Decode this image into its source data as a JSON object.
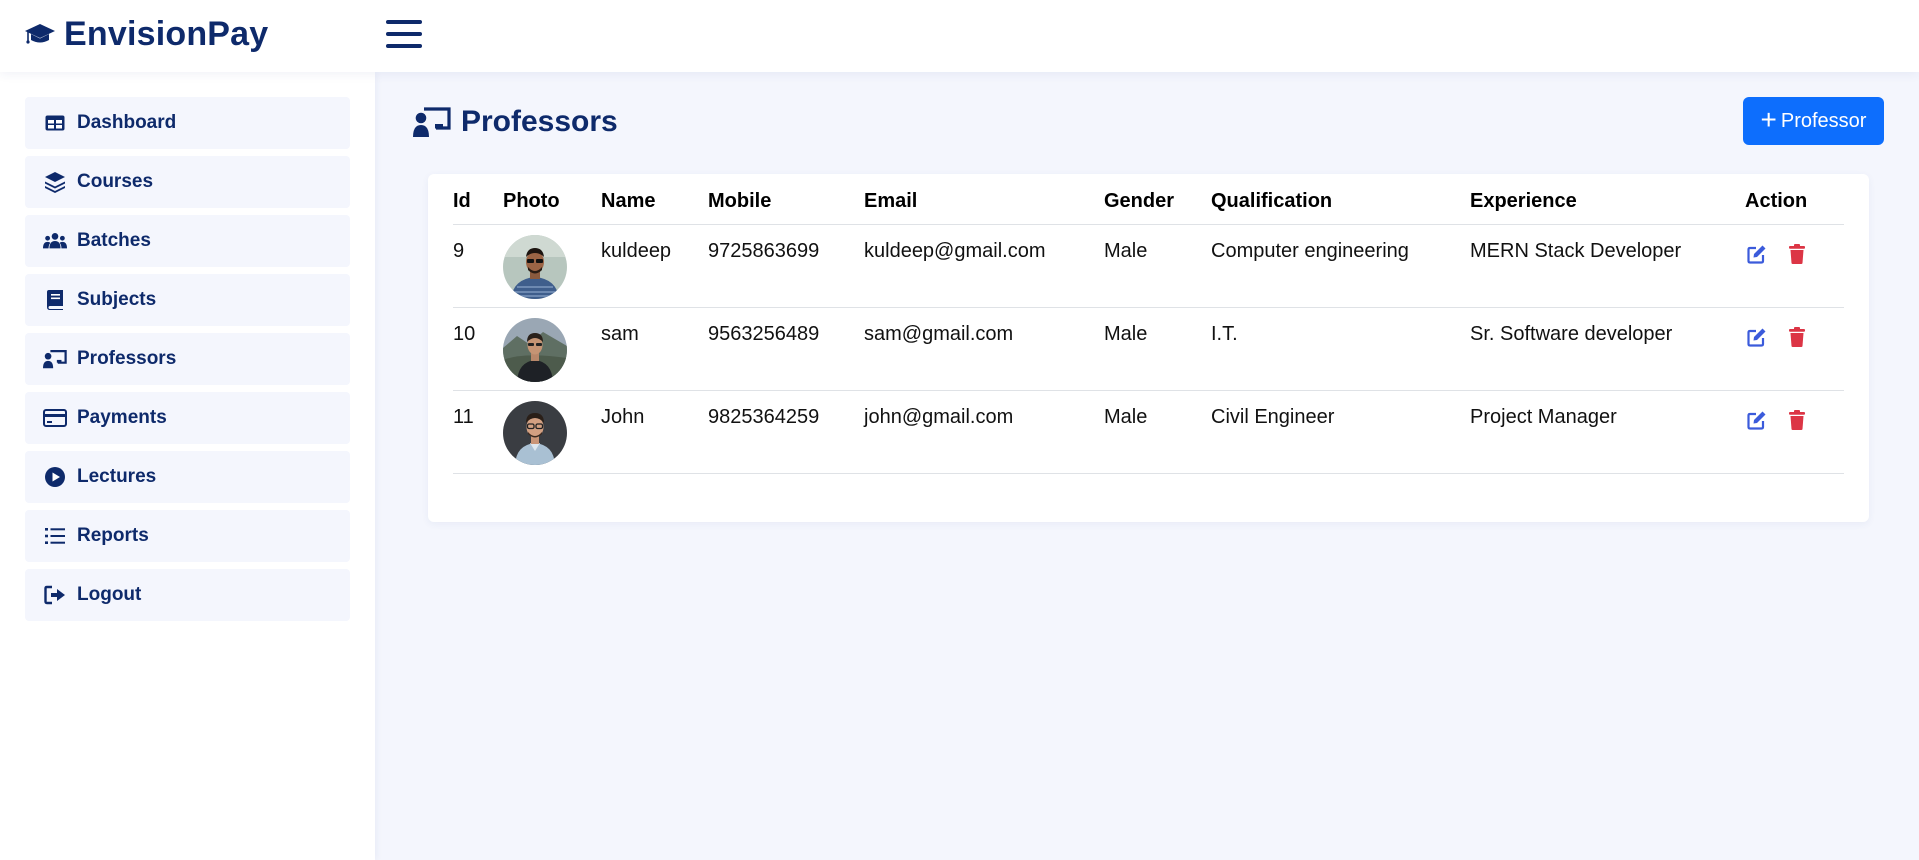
{
  "app": {
    "brand": "EnvisionPay",
    "brand_icon": "graduation-cap-icon",
    "menu_icon": "hamburger-icon"
  },
  "colors": {
    "primary": "#0e2a6b",
    "accent": "#0d6efd",
    "danger": "#dc3545",
    "edit": "#3b5bdb",
    "background": "#f4f6fd"
  },
  "sidebar": {
    "items": [
      {
        "label": "Dashboard",
        "icon": "table-icon"
      },
      {
        "label": "Courses",
        "icon": "layers-icon"
      },
      {
        "label": "Batches",
        "icon": "users-icon"
      },
      {
        "label": "Subjects",
        "icon": "book-icon"
      },
      {
        "label": "Professors",
        "icon": "chalkboard-teacher-icon"
      },
      {
        "label": "Payments",
        "icon": "credit-card-icon"
      },
      {
        "label": "Lectures",
        "icon": "play-circle-icon"
      },
      {
        "label": "Reports",
        "icon": "list-icon"
      },
      {
        "label": "Logout",
        "icon": "sign-out-icon"
      }
    ]
  },
  "page": {
    "title": "Professors",
    "title_icon": "chalkboard-teacher-icon",
    "add_button": "Professor",
    "add_icon": "plus-icon"
  },
  "table": {
    "headers": [
      "Id",
      "Photo",
      "Name",
      "Mobile",
      "Email",
      "Gender",
      "Qualification",
      "Experience",
      "Action"
    ],
    "rows": [
      {
        "id": "9",
        "photo": "avatar-kuldeep",
        "name": "kuldeep",
        "mobile": "9725863699",
        "email": "kuldeep@gmail.com",
        "gender": "Male",
        "qualification": "Computer engineering",
        "experience": "MERN Stack Developer"
      },
      {
        "id": "10",
        "photo": "avatar-sam",
        "name": "sam",
        "mobile": "9563256489",
        "email": "sam@gmail.com",
        "gender": "Male",
        "qualification": "I.T.",
        "experience": "Sr. Software developer"
      },
      {
        "id": "11",
        "photo": "avatar-john",
        "name": "John",
        "mobile": "9825364259",
        "email": "john@gmail.com",
        "gender": "Male",
        "qualification": "Civil Engineer",
        "experience": "Project Manager"
      }
    ],
    "actions": {
      "edit_icon": "edit-icon",
      "delete_icon": "trash-icon"
    }
  }
}
